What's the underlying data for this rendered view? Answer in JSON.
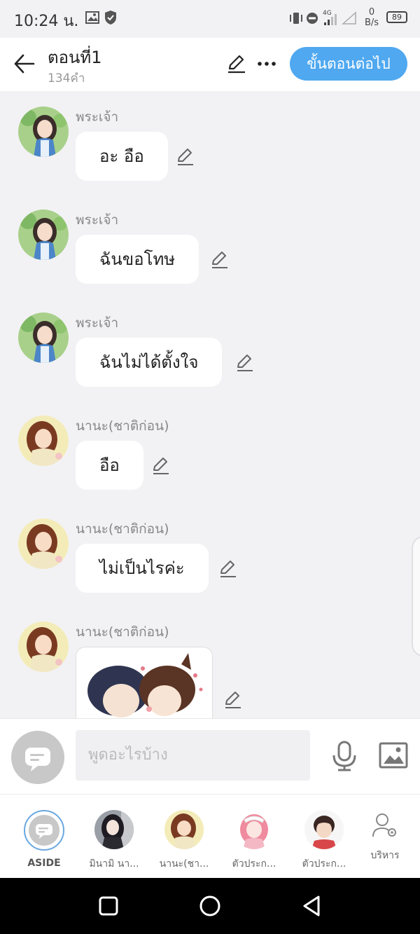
{
  "status_bar": {
    "time": "10:24 น.",
    "network_type": "4G",
    "speed_value": "0",
    "speed_unit": "B/s",
    "battery": "89"
  },
  "header": {
    "title": "ตอนที่1",
    "word_count": "134คำ",
    "next_button": "ขั้นตอนต่อไป",
    "accent_color": "#4fa8f0"
  },
  "messages": [
    {
      "sender": "พระเจ้า",
      "text": "อะ อือ",
      "avatar": "girl-dark-hair-avatar"
    },
    {
      "sender": "พระเจ้า",
      "text": "ฉันขอโทษ",
      "avatar": "girl-dark-hair-avatar"
    },
    {
      "sender": "พระเจ้า",
      "text": "ฉันไม่ได้ตั้งใจ",
      "avatar": "girl-dark-hair-avatar"
    },
    {
      "sender": "นานะ(ชาติก่อน)",
      "text": "อือ",
      "avatar": "girl-brown-hair-avatar"
    },
    {
      "sender": "นานะ(ชาติก่อน)",
      "text": "ไม่เป็นไรค่ะ",
      "avatar": "girl-brown-hair-avatar"
    },
    {
      "sender": "นานะ(ชาติก่อน)",
      "image": "sticker-two-boys",
      "avatar": "girl-brown-hair-avatar"
    }
  ],
  "composer": {
    "placeholder": "พูดอะไรบ้าง"
  },
  "characters": [
    {
      "label": "ASIDE",
      "kind": "aside"
    },
    {
      "label": "มินามิ นา...",
      "kind": "avatar"
    },
    {
      "label": "นานะ(ชา...",
      "kind": "avatar"
    },
    {
      "label": "ตัวประก...",
      "kind": "avatar"
    },
    {
      "label": "ตัวประก...",
      "kind": "avatar"
    },
    {
      "label": "บริหาร",
      "kind": "manage"
    }
  ]
}
